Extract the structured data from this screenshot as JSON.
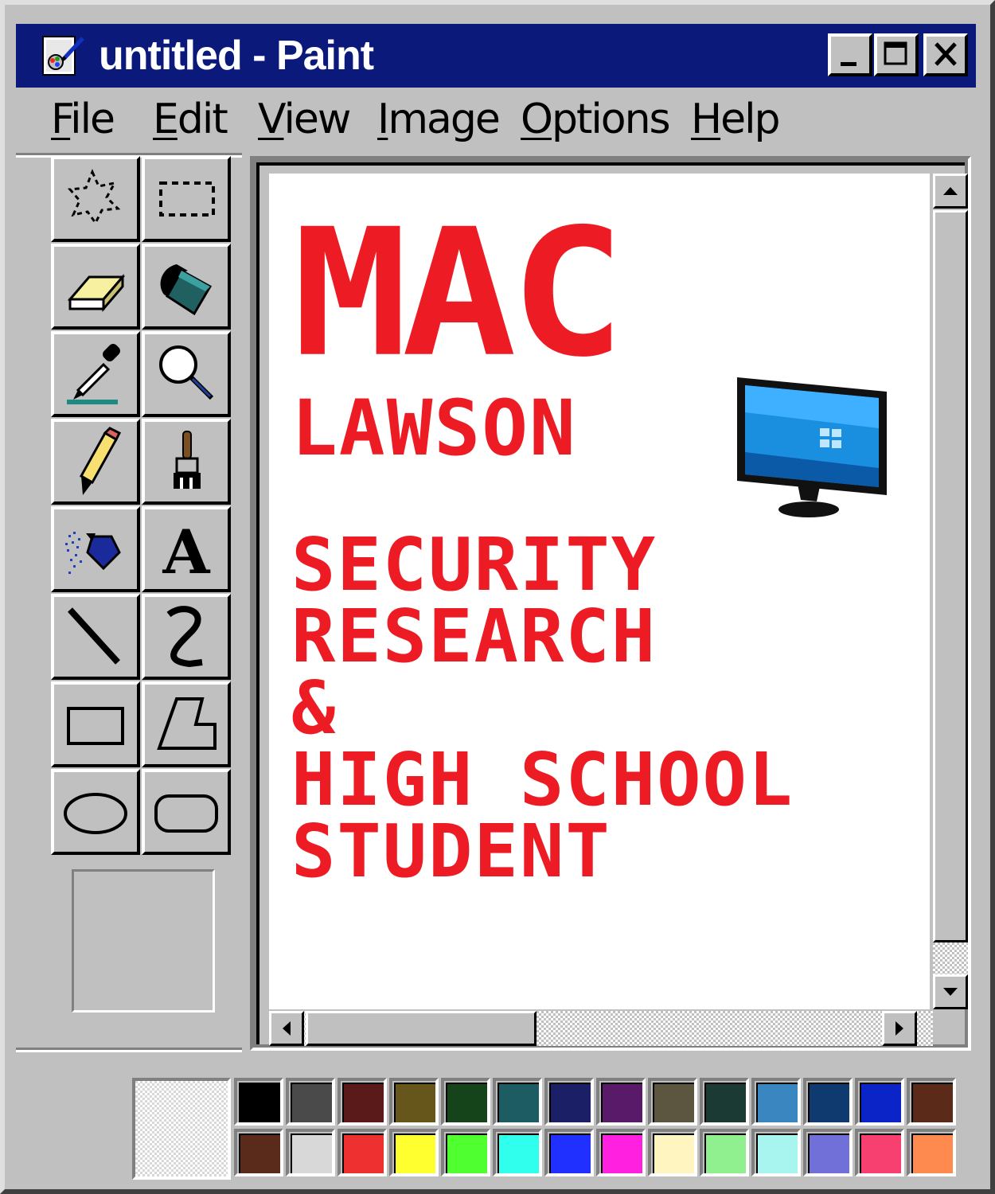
{
  "window": {
    "title": "untitled - Paint"
  },
  "menu": {
    "items": [
      {
        "label": "File",
        "accel": "F",
        "rest": "ile"
      },
      {
        "label": "Edit",
        "accel": "E",
        "rest": "dit"
      },
      {
        "label": "View",
        "accel": "V",
        "rest": "iew"
      },
      {
        "label": "Image",
        "accel": "I",
        "rest": "mage"
      },
      {
        "label": "Options",
        "accel": "O",
        "rest": "ptions"
      },
      {
        "label": "Help",
        "accel": "H",
        "rest": "elp"
      }
    ]
  },
  "tools": [
    {
      "name": "free-form-select-icon"
    },
    {
      "name": "rect-select-icon"
    },
    {
      "name": "eraser-icon"
    },
    {
      "name": "fill-bucket-icon"
    },
    {
      "name": "color-picker-icon"
    },
    {
      "name": "magnifier-icon"
    },
    {
      "name": "pencil-icon"
    },
    {
      "name": "brush-icon"
    },
    {
      "name": "airbrush-icon"
    },
    {
      "name": "text-tool-icon"
    },
    {
      "name": "line-icon"
    },
    {
      "name": "curve-icon"
    },
    {
      "name": "rectangle-icon"
    },
    {
      "name": "polygon-icon"
    },
    {
      "name": "ellipse-icon"
    },
    {
      "name": "rounded-rect-icon"
    }
  ],
  "canvas": {
    "text_color": "#ed1c24",
    "lines": {
      "title": "MAC",
      "name": "LAWSON",
      "role1": "SECURITY",
      "role2": "RESEARCH",
      "role3": "&",
      "role4": "HIGH SCHOOL",
      "role5": "STUDENT"
    },
    "image": "monitor-icon"
  },
  "palette": {
    "row1": [
      "#000000",
      "#4a4a4a",
      "#5b1a1a",
      "#66561c",
      "#16441a",
      "#1d5c62",
      "#1a1f66",
      "#5a1a6a",
      "#5c5540",
      "#1b3a33",
      "#3a86c0",
      "#0f3a70",
      "#0a24c8",
      "#5c2a18"
    ],
    "row2": [
      "#5a2a1a",
      "#d8d8d8",
      "#ee3030",
      "#ffff30",
      "#50ff30",
      "#30ffee",
      "#2030ff",
      "#ff20e0",
      "#fff5c0",
      "#90f090",
      "#a8f5f0",
      "#7070d8",
      "#f84070",
      "#ff8a50"
    ]
  }
}
